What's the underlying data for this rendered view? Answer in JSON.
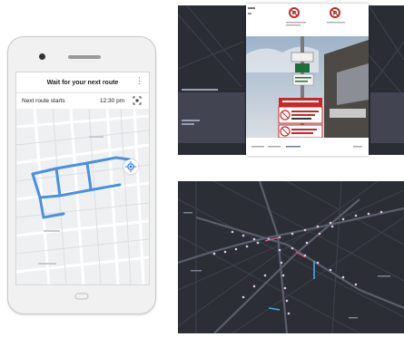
{
  "app": {
    "title": "Wait for your next route",
    "next_route_label": "Next route starts",
    "next_route_time": "12:30 pm"
  },
  "icons": {
    "menu": "more-vert-icon",
    "scan": "qr-scan-icon",
    "locate": "my-location-icon",
    "info": "info-icon",
    "no_parking": "no-parking-sign-icon"
  },
  "colors": {
    "route_blue": "#4a90e2",
    "dark_map_bg": "#2b2e34",
    "road_dark": "#4a4e58",
    "road_light": "#ffffff"
  }
}
